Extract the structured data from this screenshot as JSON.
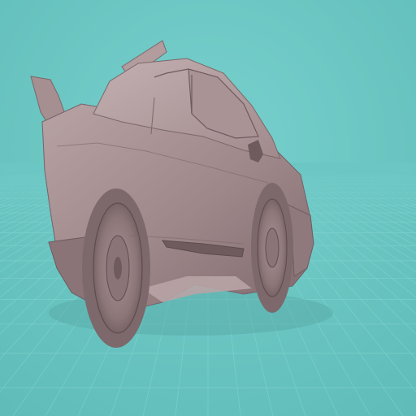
{
  "scene": {
    "background_color": "#6cc7c4",
    "grid_line_color": "#86d7d3",
    "model_color": "#9e8789",
    "model_highlight_color": "#b9a3a5",
    "model_shadow_color": "#6f5b5e",
    "model_name": "low-poly-sports-car",
    "shows_text": false
  }
}
